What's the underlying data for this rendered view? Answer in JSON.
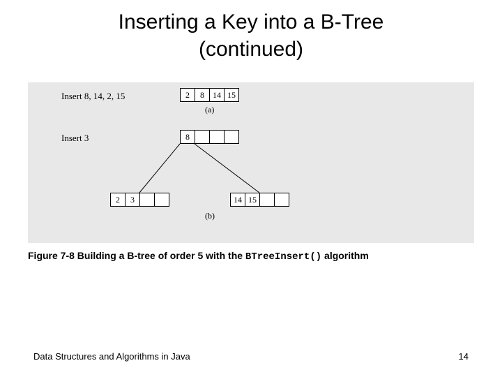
{
  "title_line1": "Inserting a Key into a B-Tree",
  "title_line2": "(continued)",
  "figure": {
    "a": {
      "label": "Insert 8, 14, 2, 15",
      "cells": [
        "2",
        "8",
        "14",
        "15"
      ],
      "sub": "(a)"
    },
    "b": {
      "label": "Insert 3",
      "root": [
        "8",
        "",
        "",
        ""
      ],
      "left": [
        "2",
        "3",
        "",
        ""
      ],
      "right": [
        "14",
        "15",
        "",
        ""
      ],
      "sub": "(b)"
    }
  },
  "caption": {
    "prefix": "Figure 7-8 Building a B-tree of order 5 with the ",
    "code": "BTreeInsert()",
    "suffix": " algorithm"
  },
  "footer_left": "Data Structures and Algorithms in Java",
  "footer_right": "14"
}
